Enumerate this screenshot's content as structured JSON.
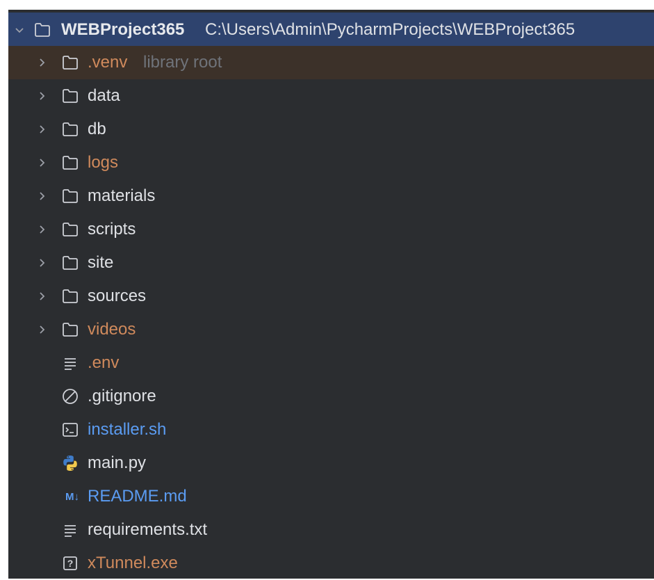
{
  "tree": {
    "root": {
      "name": "WEBProject365",
      "path": "C:\\Users\\Admin\\PycharmProjects\\WEBProject365"
    },
    "items": [
      {
        "label": ".venv",
        "hint": "library root",
        "type": "folder",
        "color": "#d08a5c"
      },
      {
        "label": "data",
        "type": "folder",
        "color": "#dfe1e5"
      },
      {
        "label": "db",
        "type": "folder",
        "color": "#dfe1e5"
      },
      {
        "label": "logs",
        "type": "folder",
        "color": "#d08a5c"
      },
      {
        "label": "materials",
        "type": "folder",
        "color": "#dfe1e5"
      },
      {
        "label": "scripts",
        "type": "folder",
        "color": "#dfe1e5"
      },
      {
        "label": "site",
        "type": "folder",
        "color": "#dfe1e5"
      },
      {
        "label": "sources",
        "type": "folder",
        "color": "#dfe1e5"
      },
      {
        "label": "videos",
        "type": "folder",
        "color": "#d08a5c"
      },
      {
        "label": ".env",
        "type": "text-file",
        "color": "#d08a5c"
      },
      {
        "label": ".gitignore",
        "type": "ignore-file",
        "color": "#dfe1e5"
      },
      {
        "label": "installer.sh",
        "type": "shell-file",
        "color": "#5b9cf2"
      },
      {
        "label": "main.py",
        "type": "python-file",
        "color": "#dfe1e5"
      },
      {
        "label": "README.md",
        "type": "markdown-file",
        "icon_text": "M↓",
        "color": "#5b9cf2"
      },
      {
        "label": "requirements.txt",
        "type": "text-file",
        "color": "#dfe1e5"
      },
      {
        "label": "xTunnel.exe",
        "type": "unknown-file",
        "icon_text": "?",
        "color": "#d08a5c"
      }
    ]
  },
  "colors": {
    "panel_bg": "#2b2d30",
    "selected_bg": "#2e436e",
    "excluded_bg": "#3c3129",
    "modified": "#d08a5c",
    "added": "#5b9cf2",
    "hint": "#6f737a"
  }
}
